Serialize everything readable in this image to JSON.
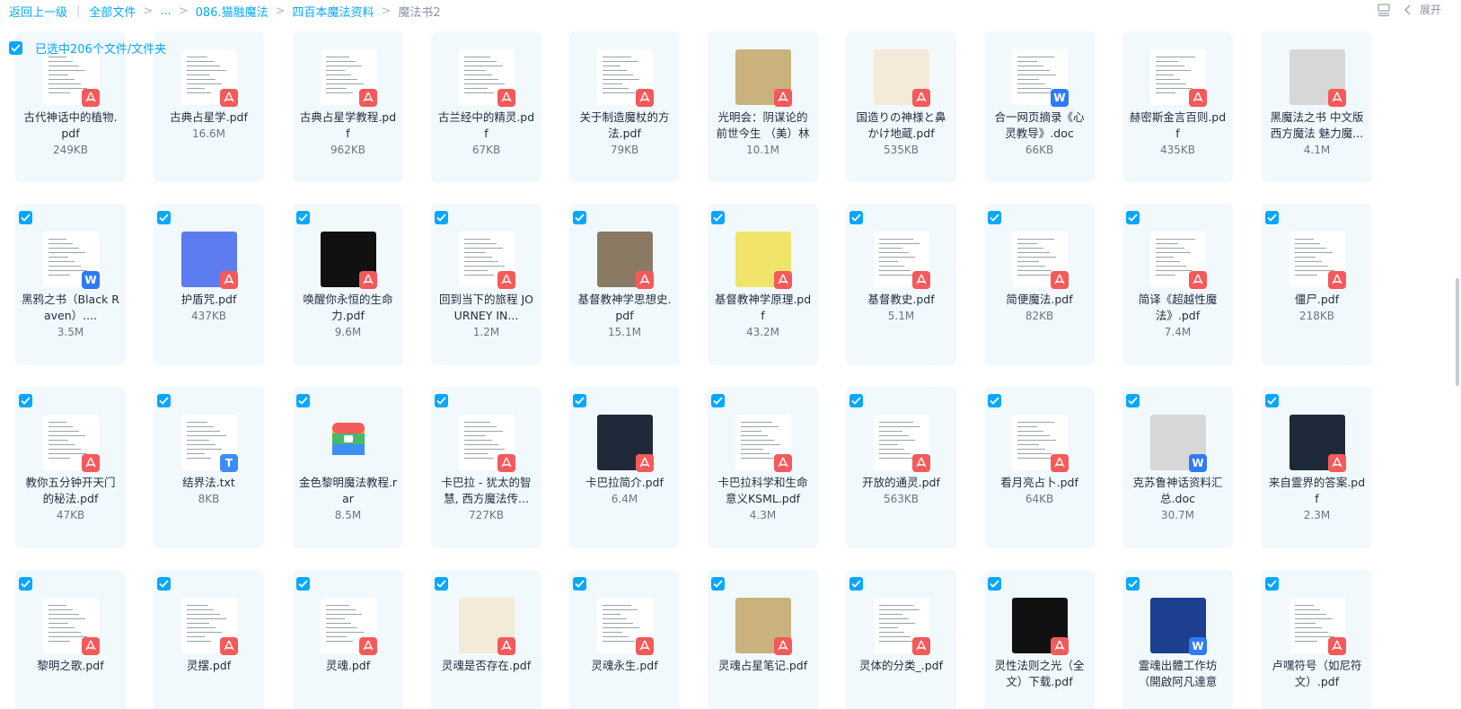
{
  "breadcrumb": {
    "back": "返回上一级",
    "all": "全部文件",
    "ellipsis": "...",
    "level1": "086.猫融魔法",
    "level2": "四百本魔法资料",
    "current": "魔法书2"
  },
  "toolbar": {
    "expand_label": "展开"
  },
  "selection": {
    "text": "已选中206个文件/文件夹"
  },
  "rows": [
    [
      {
        "name": "古代神话中的植物.pdf",
        "size": "249KB",
        "icon": "pdf"
      },
      {
        "name": "古典占星学.pdf",
        "size": "16.6M",
        "icon": "pdf"
      },
      {
        "name": "古典占星学教程.pdf",
        "size": "962KB",
        "icon": "pdf"
      },
      {
        "name": "古兰经中的精灵.pdf",
        "size": "67KB",
        "icon": "pdf"
      },
      {
        "name": "关于制造魔杖的方法.pdf",
        "size": "79KB",
        "icon": "pdf"
      },
      {
        "name": "光明会：阴谋论的前世今生 （美）林",
        "size": "10.1M",
        "icon": "pdf"
      },
      {
        "name": "国造りの神様と鼻かけ地蔵.pdf",
        "size": "535KB",
        "icon": "pdf"
      },
      {
        "name": "合一网页摘录《心灵教导》.doc",
        "size": "66KB",
        "icon": "doc"
      },
      {
        "name": "赫密斯金言百则.pdf",
        "size": "435KB",
        "icon": "pdf"
      },
      {
        "name": "黑魔法之书 中文版 西方魔法 魅力魔...",
        "size": "4.1M",
        "icon": "pdf"
      }
    ],
    [
      {
        "name": "黑鸦之书（Black Raven）....",
        "size": "3.5M",
        "icon": "doc"
      },
      {
        "name": "护盾咒.pdf",
        "size": "437KB",
        "icon": "pdf"
      },
      {
        "name": "唤醒你永恒的生命力.pdf",
        "size": "9.6M",
        "icon": "pdf"
      },
      {
        "name": "回到当下的旅程 JOURNEY IN...",
        "size": "1.2M",
        "icon": "pdf"
      },
      {
        "name": "基督教神学思想史.pdf",
        "size": "15.1M",
        "icon": "pdf"
      },
      {
        "name": "基督教神学原理.pdf",
        "size": "43.2M",
        "icon": "pdf"
      },
      {
        "name": "基督教史.pdf",
        "size": "5.1M",
        "icon": "pdf"
      },
      {
        "name": "简便魔法.pdf",
        "size": "82KB",
        "icon": "pdf"
      },
      {
        "name": "简译《超越性魔法》.pdf",
        "size": "7.4M",
        "icon": "pdf"
      },
      {
        "name": "僵尸.pdf",
        "size": "218KB",
        "icon": "pdf"
      }
    ],
    [
      {
        "name": "教你五分钟开天门的秘法.pdf",
        "size": "47KB",
        "icon": "pdf"
      },
      {
        "name": "结界法.txt",
        "size": "8KB",
        "icon": "txt"
      },
      {
        "name": "金色黎明魔法教程.rar",
        "size": "8.5M",
        "icon": "rar"
      },
      {
        "name": "卡巴拉 - 犹太的智慧, 西方魔法传...",
        "size": "727KB",
        "icon": "pdf"
      },
      {
        "name": "卡巴拉简介.pdf",
        "size": "6.4M",
        "icon": "pdf"
      },
      {
        "name": "卡巴拉科学和生命意义KSML.pdf",
        "size": "4.3M",
        "icon": "pdf"
      },
      {
        "name": "开放的通灵.pdf",
        "size": "563KB",
        "icon": "pdf"
      },
      {
        "name": "看月亮占卜.pdf",
        "size": "64KB",
        "icon": "pdf"
      },
      {
        "name": "克苏鲁神话资料汇总.doc",
        "size": "30.7M",
        "icon": "doc"
      },
      {
        "name": "来自霊界的答案.pdf",
        "size": "2.3M",
        "icon": "pdf"
      }
    ],
    [
      {
        "name": "黎明之歌.pdf",
        "size": "",
        "icon": "pdf"
      },
      {
        "name": "灵摆.pdf",
        "size": "",
        "icon": "pdf"
      },
      {
        "name": "灵魂.pdf",
        "size": "",
        "icon": "pdf"
      },
      {
        "name": "灵魂是否存在.pdf",
        "size": "",
        "icon": "pdf"
      },
      {
        "name": "灵魂永生.pdf",
        "size": "",
        "icon": "pdf"
      },
      {
        "name": "灵魂占星笔记.pdf",
        "size": "",
        "icon": "pdf"
      },
      {
        "name": "灵体的分类_.pdf",
        "size": "",
        "icon": "pdf"
      },
      {
        "name": "灵性法则之光（全文）下载.pdf",
        "size": "",
        "icon": "pdf"
      },
      {
        "name": "霊魂出體工作坊（開啟阿凡達意識...",
        "size": "",
        "icon": "doc"
      },
      {
        "name": "卢嘿符号（如尼符文）.pdf",
        "size": "",
        "icon": "pdf"
      }
    ]
  ]
}
